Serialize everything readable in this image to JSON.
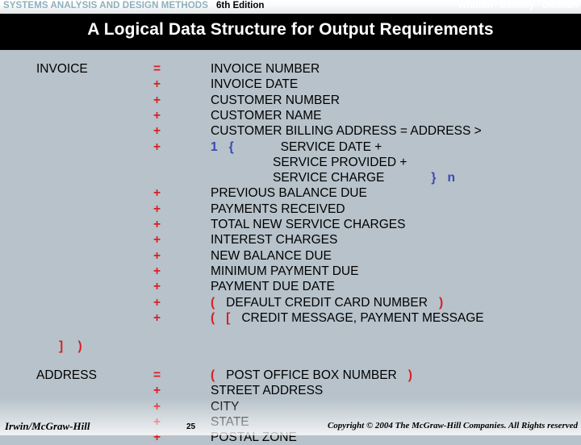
{
  "banner": {
    "book_title": "SYSTEMS ANALYSIS AND DESIGN METHODS",
    "edition": "6th Edition",
    "authors": [
      "Whitten",
      "Bentley",
      "Dittman"
    ],
    "book_title_color": "#8fb0bd",
    "authors_color": "#ffffff"
  },
  "title_bar": {
    "title": "A Logical Data Structure for Output Requirements",
    "background_color": "#000000",
    "text_color": "#ffffff"
  },
  "colors": {
    "slide_background": "#b7c2ca",
    "operator_red": "#d81f26",
    "repetition_blue": "#3b46b4",
    "text_black": "#000000"
  },
  "structure": {
    "rows": [
      {
        "entity": "INVOICE",
        "operator": "=",
        "attribute": "INVOICE NUMBER",
        "indent": false
      },
      {
        "entity": "",
        "operator": "+",
        "attribute": "INVOICE DATE",
        "indent": false
      },
      {
        "entity": "",
        "operator": "+",
        "attribute": "CUSTOMER NUMBER",
        "indent": false
      },
      {
        "entity": "",
        "operator": "+",
        "attribute": "CUSTOMER NAME",
        "indent": false
      },
      {
        "entity": "",
        "operator": "+",
        "attribute": "CUSTOMER BILLING ADDRESS = ADDRESS >",
        "indent": false
      },
      {
        "entity": "",
        "operator": "+",
        "attribute": "",
        "indent": false,
        "parts": [
          {
            "text": "1",
            "color": "blue"
          },
          {
            "text": " ",
            "spacer": "sm"
          },
          {
            "text": "{",
            "color": "blue"
          },
          {
            "text": " ",
            "spacer": "lg"
          },
          {
            "text": "SERVICE DATE +",
            "color": "black"
          }
        ]
      },
      {
        "entity": "",
        "operator": "",
        "attribute": "SERVICE PROVIDED +",
        "indent": true
      },
      {
        "entity": "",
        "operator": "",
        "attribute": "",
        "indent": true,
        "parts": [
          {
            "text": "SERVICE CHARGE",
            "color": "black"
          },
          {
            "text": " ",
            "spacer": "lg"
          },
          {
            "text": "}",
            "color": "blue"
          },
          {
            "text": " ",
            "spacer": "sm"
          },
          {
            "text": "n",
            "color": "blue"
          }
        ]
      },
      {
        "entity": "",
        "operator": "+",
        "attribute": "PREVIOUS BALANCE DUE",
        "indent": false
      },
      {
        "entity": "",
        "operator": "+",
        "attribute": "PAYMENTS RECEIVED",
        "indent": false
      },
      {
        "entity": "",
        "operator": "+",
        "attribute": "TOTAL NEW SERVICE CHARGES",
        "indent": false
      },
      {
        "entity": "",
        "operator": "+",
        "attribute": "INTEREST CHARGES",
        "indent": false
      },
      {
        "entity": "",
        "operator": "+",
        "attribute": "NEW BALANCE DUE",
        "indent": false
      },
      {
        "entity": "",
        "operator": "+",
        "attribute": "MINIMUM PAYMENT DUE",
        "indent": false
      },
      {
        "entity": "",
        "operator": "+",
        "attribute": "PAYMENT DUE DATE",
        "indent": false
      },
      {
        "entity": "",
        "operator": "+",
        "attribute": "",
        "indent": false,
        "parts": [
          {
            "text": "(",
            "color": "red"
          },
          {
            "text": " ",
            "spacer": "sm"
          },
          {
            "text": "DEFAULT CREDIT CARD NUMBER",
            "color": "black"
          },
          {
            "text": " ",
            "spacer": "sm"
          },
          {
            "text": ")",
            "color": "red"
          }
        ]
      },
      {
        "entity": "",
        "operator": "+",
        "attribute": "",
        "indent": false,
        "parts": [
          {
            "text": "(",
            "color": "red"
          },
          {
            "text": " ",
            "spacer": "sm"
          },
          {
            "text": "[",
            "color": "red"
          },
          {
            "text": " ",
            "spacer": "sm"
          },
          {
            "text": "CREDIT MESSAGE, PAYMENT MESSAGE",
            "color": "black"
          }
        ]
      }
    ],
    "close_group": "] )",
    "address_rows": [
      {
        "entity": "ADDRESS",
        "operator": "=",
        "attribute": "",
        "indent": false,
        "parts": [
          {
            "text": "(",
            "color": "red"
          },
          {
            "text": " ",
            "spacer": "sm"
          },
          {
            "text": "POST OFFICE BOX NUMBER",
            "color": "black"
          },
          {
            "text": " ",
            "spacer": "sm"
          },
          {
            "text": ")",
            "color": "red"
          }
        ]
      },
      {
        "entity": "",
        "operator": "+",
        "attribute": "STREET ADDRESS",
        "indent": false
      },
      {
        "entity": "",
        "operator": "+",
        "attribute": "CITY",
        "indent": false
      },
      {
        "entity": "",
        "operator": "+",
        "attribute": "STATE",
        "indent": false
      },
      {
        "entity": "",
        "operator": "+",
        "attribute": "POSTAL ZONE",
        "indent": false
      }
    ]
  },
  "footer": {
    "publisher": "Irwin/McGraw-Hill",
    "page_number": "25",
    "copyright": "Copyright © 2004 The McGraw-Hill Companies. All Rights reserved"
  }
}
